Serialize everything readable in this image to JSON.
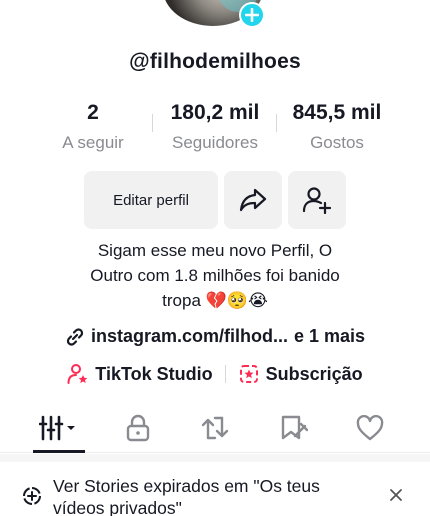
{
  "profile": {
    "username": "@filhodemilhoes"
  },
  "stats": [
    {
      "value": "2",
      "label": "A seguir"
    },
    {
      "value": "180,2 mil",
      "label": "Seguidores"
    },
    {
      "value": "845,5 mil",
      "label": "Gostos"
    }
  ],
  "actions": {
    "edit_label": "Editar perfil",
    "share_icon": "share-arrow-icon",
    "add_friend_icon": "add-user-icon"
  },
  "bio": {
    "line1": "Sigam esse meu novo Perfil, O",
    "line2": "Outro com 1.8 milhões foi banido",
    "line3": "tropa 💔🥺😭"
  },
  "link": {
    "url": "instagram.com/filhod...",
    "more": "e 1 mais"
  },
  "tools": {
    "studio": "TikTok Studio",
    "subscription": "Subscrição"
  },
  "tabs": [
    {
      "icon": "videos-grid-icon",
      "active": true
    },
    {
      "icon": "lock-icon",
      "active": false
    },
    {
      "icon": "repost-icon",
      "active": false
    },
    {
      "icon": "tagged-bookmark-icon",
      "active": false
    },
    {
      "icon": "heart-icon",
      "active": false
    }
  ],
  "banner": {
    "text_line1": "Ver Stories expirados em \"Os teus",
    "text_line2": "vídeos privados\""
  },
  "colors": {
    "accent_cyan": "#20d5ec",
    "tiktok_red": "#fe2c55",
    "text_primary": "#161823",
    "text_secondary": "#8a8b91",
    "button_bg": "#f1f1f2"
  }
}
